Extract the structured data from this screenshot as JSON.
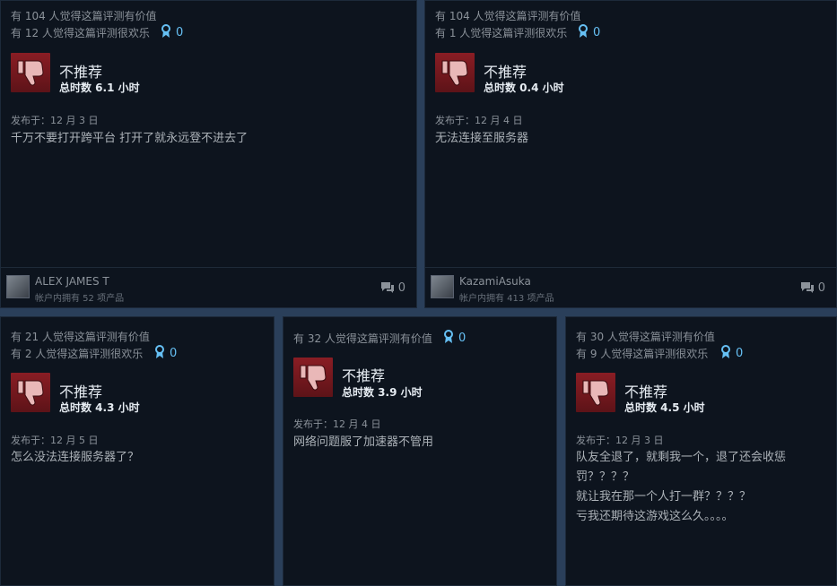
{
  "reviews": [
    {
      "helpful": "有 104 人觉得这篇评测有价值",
      "funny": "有 12 人觉得这篇评测很欢乐",
      "awards": "0",
      "verdict": "不推荐",
      "hours": "总时数 6.1 小时",
      "posted": "发布于：12 月 3 日",
      "lines": [
        "千万不要打开跨平台 打开了就永远登不进去了"
      ],
      "author": "ALEX JAMES T",
      "owned": "帐户内拥有 52 项产品",
      "comments": "0"
    },
    {
      "helpful": "有 104 人觉得这篇评测有价值",
      "funny": "有 1 人觉得这篇评测很欢乐",
      "awards": "0",
      "verdict": "不推荐",
      "hours": "总时数 0.4 小时",
      "posted": "发布于：12 月 4 日",
      "lines": [
        "无法连接至服务器"
      ],
      "author": "KazamiAsuka",
      "owned": "帐户内拥有 413 项产品",
      "comments": "0"
    },
    {
      "helpful": "有 21 人觉得这篇评测有价值",
      "funny": "有 2 人觉得这篇评测很欢乐",
      "awards": "0",
      "verdict": "不推荐",
      "hours": "总时数 4.3 小时",
      "posted": "发布于：12 月 5 日",
      "lines": [
        "怎么没法连接服务器了？"
      ]
    },
    {
      "helpful": "有 32 人觉得这篇评测有价值",
      "awards": "0",
      "verdict": "不推荐",
      "hours": "总时数 3.9 小时",
      "posted": "发布于：12 月 4 日",
      "lines": [
        "网络问题服了加速器不管用"
      ]
    },
    {
      "helpful": "有 30 人觉得这篇评测有价值",
      "funny": "有 9 人觉得这篇评测很欢乐",
      "awards": "0",
      "verdict": "不推荐",
      "hours": "总时数 4.5 小时",
      "posted": "发布于：12 月 3 日",
      "lines": [
        "队友全退了，就剩我一个，退了还会收惩",
        "罚？？？？",
        "就让我在那一个人打一群？？？？",
        "亏我还期待这游戏这么久。。。。"
      ]
    }
  ],
  "colors": {
    "accent": "#66c0f4",
    "thumb_bg": "#7a1a20",
    "card_bg": "#0d141e"
  }
}
